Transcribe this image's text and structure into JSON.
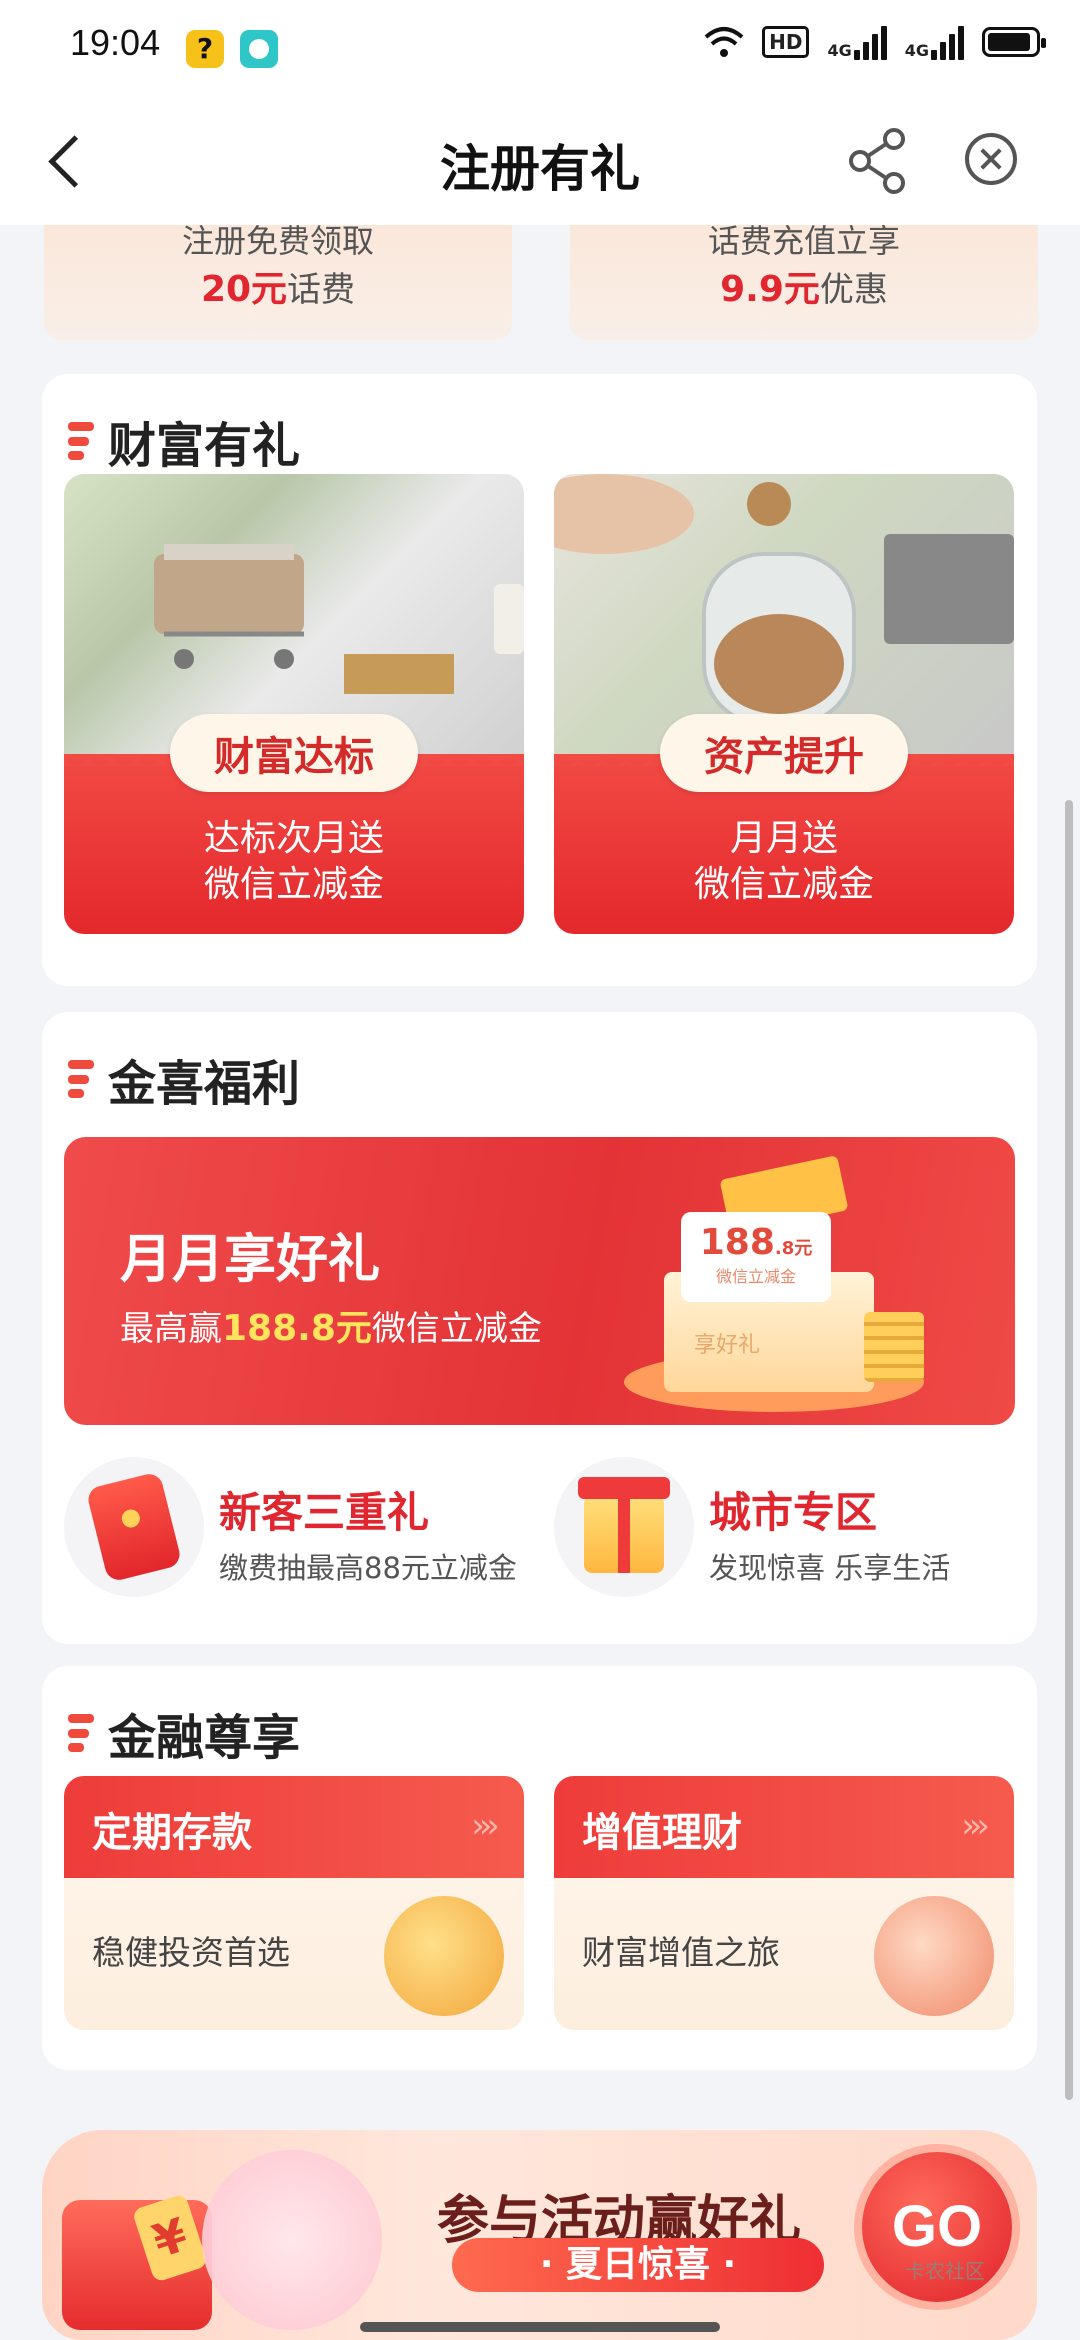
{
  "status_bar": {
    "time": "19:04",
    "hd": "HD",
    "net1": "4G",
    "net2": "4G"
  },
  "nav": {
    "title": "注册有礼"
  },
  "top_cards": [
    {
      "line1": "注册免费领取",
      "highlight": "20元",
      "suffix": "话费"
    },
    {
      "line1": "话费充值立享",
      "highlight": "9.9元",
      "suffix": "优惠"
    }
  ],
  "wealth": {
    "title": "财富有礼",
    "cards": [
      {
        "pill": "财富达标",
        "line1": "达标次月送",
        "line2": "微信立减金"
      },
      {
        "pill": "资产提升",
        "line1": "月月送",
        "line2": "微信立减金"
      }
    ]
  },
  "jinxi": {
    "title": "金喜福利",
    "banner": {
      "title": "月月享好礼",
      "sub_prefix": "最高赢",
      "sub_highlight": "188.8元",
      "sub_suffix": "微信立减金",
      "card_value": "188",
      "card_decimal": ".8元",
      "card_text": "微信立减金",
      "box_text": "享好礼"
    },
    "items": [
      {
        "title": "新客三重礼",
        "desc": "缴费抽最高88元立减金"
      },
      {
        "title": "城市专区",
        "desc": "发现惊喜 乐享生活"
      }
    ]
  },
  "finance": {
    "title": "金融尊享",
    "cards": [
      {
        "title": "定期存款",
        "desc": "稳健投资首选"
      },
      {
        "title": "增值理财",
        "desc": "财富增值之旅"
      }
    ],
    "arrow": "›››"
  },
  "bottom_banner": {
    "title": "参与活动赢好礼",
    "sub": "· 夏日惊喜 ·",
    "go": "GO",
    "envelope_symbol": "¥",
    "watermark": "卡农社区"
  },
  "colors": {
    "accent": "#e4282c",
    "background": "#f3f4f8"
  }
}
